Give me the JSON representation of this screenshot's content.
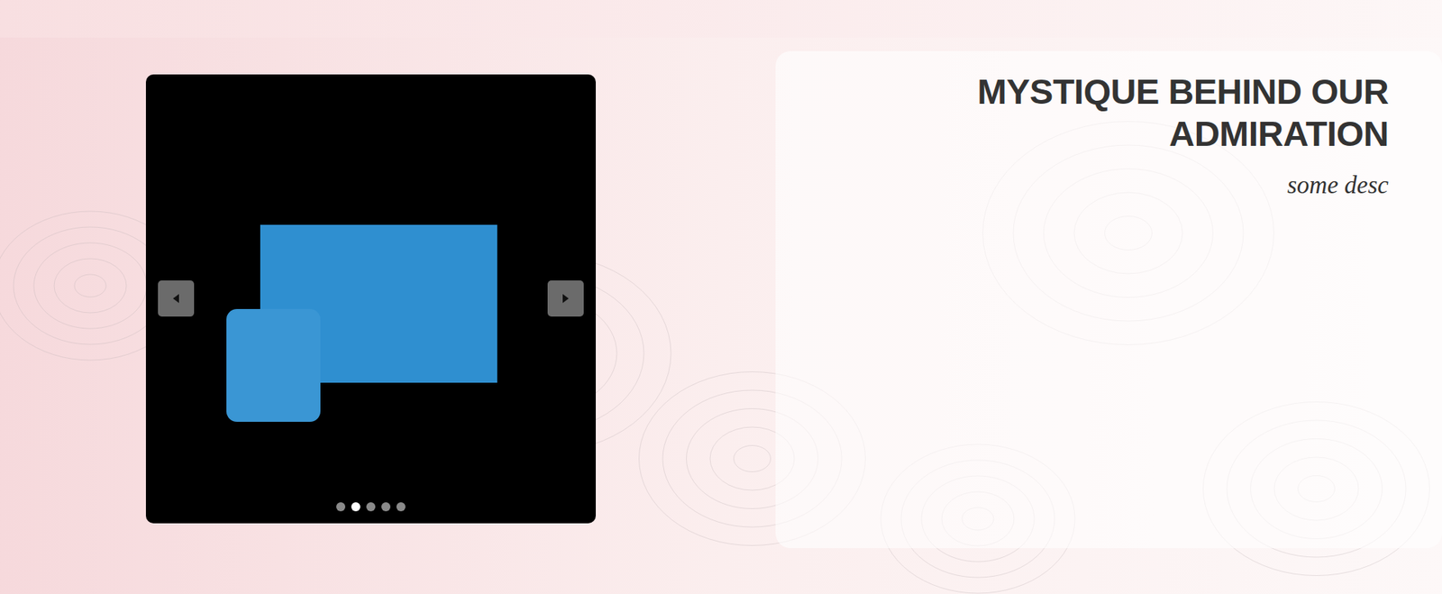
{
  "hero": {
    "title": "MYSTIQUE BEHIND OUR ADMIRATION",
    "description": "some desc"
  },
  "carousel": {
    "slides": [
      {
        "selected": false
      },
      {
        "selected": true
      },
      {
        "selected": false
      },
      {
        "selected": false
      },
      {
        "selected": false
      }
    ]
  }
}
